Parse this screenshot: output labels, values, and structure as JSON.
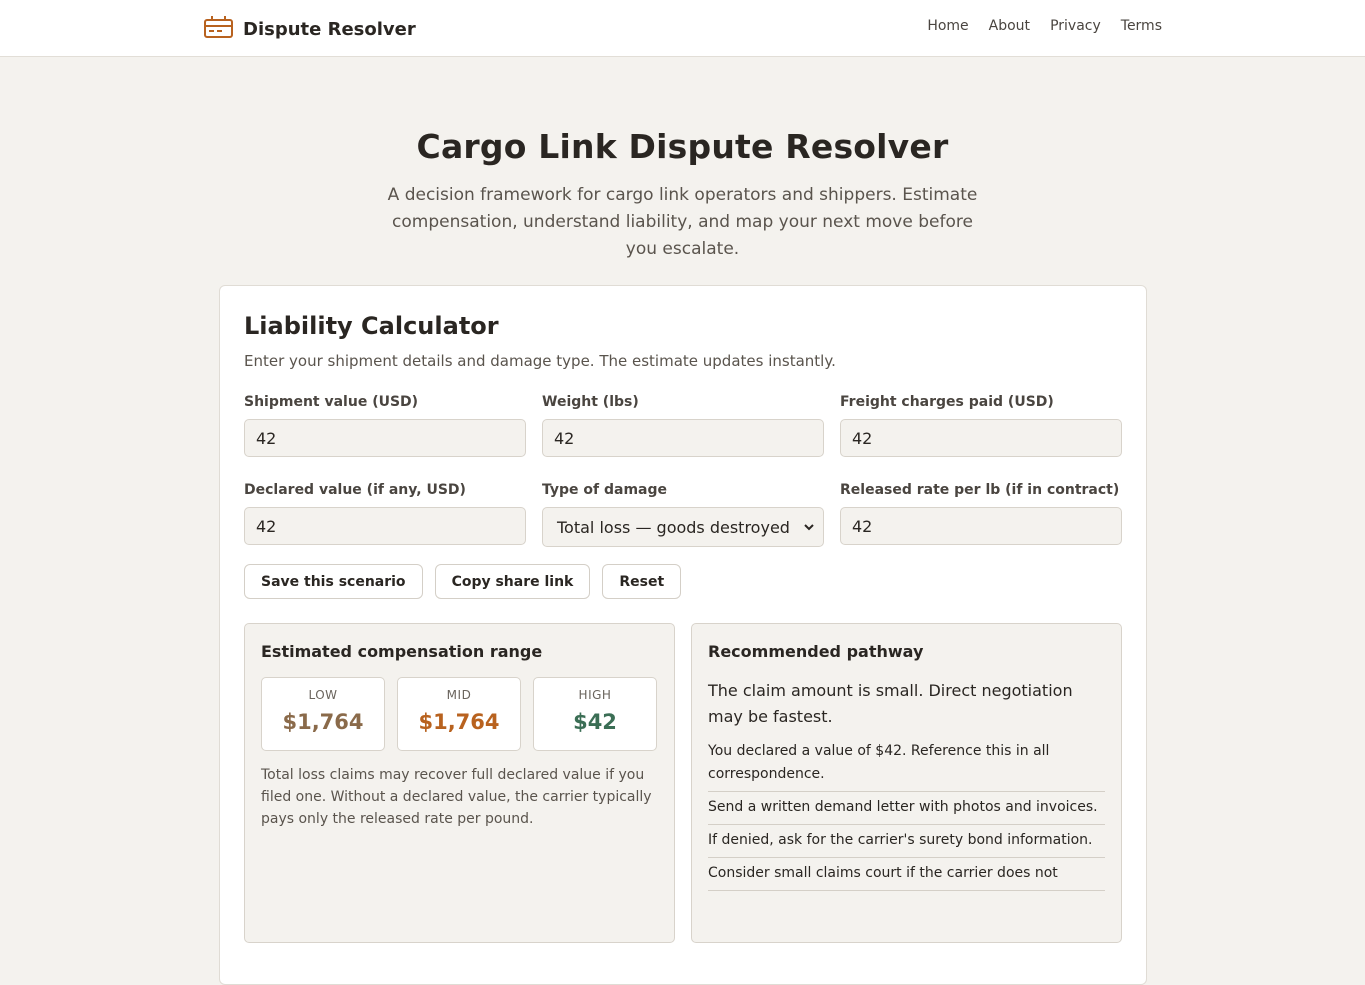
{
  "header": {
    "brand": "Dispute Resolver",
    "nav": [
      "Home",
      "About",
      "Privacy",
      "Terms"
    ]
  },
  "hero": {
    "title": "Cargo Link Dispute Resolver",
    "subtitle": "A decision framework for cargo link operators and shippers. Estimate compensation, understand liability, and map your next move before you escalate."
  },
  "calculator": {
    "title": "Liability Calculator",
    "subtitle": "Enter your shipment details and damage type. The estimate updates instantly.",
    "fields": {
      "shipment_value": {
        "label": "Shipment value (USD)",
        "value": "42"
      },
      "weight": {
        "label": "Weight (lbs)",
        "value": "42"
      },
      "freight": {
        "label": "Freight charges paid (USD)",
        "value": "42"
      },
      "declared": {
        "label": "Declared value (if any, USD)",
        "value": "42"
      },
      "damage_type": {
        "label": "Type of damage",
        "value": "Total loss — goods destroyed"
      },
      "released_rate": {
        "label": "Released rate per lb (if in contract)",
        "value": "42"
      }
    },
    "buttons": {
      "save": "Save this scenario",
      "copy": "Copy share link",
      "reset": "Reset"
    }
  },
  "estimate": {
    "title": "Estimated compensation range",
    "low": {
      "label": "LOW",
      "value": "$1,764",
      "color": "#8a6a4a"
    },
    "mid": {
      "label": "MID",
      "value": "$1,764",
      "color": "#b8621f"
    },
    "high": {
      "label": "HIGH",
      "value": "$42",
      "color": "#3b6e55"
    },
    "note": "Total loss claims may recover full declared value if you filed one. Without a declared value, the carrier typically pays only the released rate per pound."
  },
  "pathway": {
    "title": "Recommended pathway",
    "lead": "The claim amount is small. Direct negotiation may be fastest.",
    "steps": [
      "You declared a value of $42. Reference this in all correspondence.",
      "Send a written demand letter with photos and invoices.",
      "If denied, ask for the carrier's surety bond information.",
      "Consider small claims court if the carrier does not"
    ]
  },
  "colors": {
    "accent": "#b8621f",
    "background": "#f4f2ee"
  }
}
